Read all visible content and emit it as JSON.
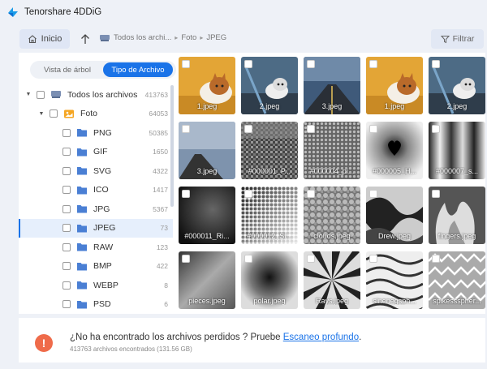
{
  "app": {
    "title": "Tenorshare 4DDiG"
  },
  "nav": {
    "home_label": "Inicio",
    "breadcrumb": [
      "Todos los archi...",
      "Foto",
      "JPEG"
    ],
    "filter_label": "Filtrar"
  },
  "sidebar": {
    "view_tree_label": "Vista de árbol",
    "view_type_label": "Tipo de Archivo",
    "all_files": {
      "label": "Todos los archivos",
      "count": "413763"
    },
    "photo": {
      "label": "Foto",
      "count": "64053"
    },
    "items": [
      {
        "label": "PNG",
        "count": "50385"
      },
      {
        "label": "GIF",
        "count": "1650"
      },
      {
        "label": "SVG",
        "count": "4322"
      },
      {
        "label": "ICO",
        "count": "1417"
      },
      {
        "label": "JPG",
        "count": "5367"
      },
      {
        "label": "JPEG",
        "count": "73"
      },
      {
        "label": "RAW",
        "count": "123"
      },
      {
        "label": "BMP",
        "count": "422"
      },
      {
        "label": "WEBP",
        "count": "8"
      },
      {
        "label": "PSD",
        "count": "6"
      }
    ]
  },
  "files": [
    {
      "name": "1.jpeg"
    },
    {
      "name": "2.jpeg"
    },
    {
      "name": "3.jpeg"
    },
    {
      "name": "1.jpeg"
    },
    {
      "name": "2.jpeg"
    },
    {
      "name": "3.jpeg"
    },
    {
      "name": "#000001_P..."
    },
    {
      "name": "#000004_pi..."
    },
    {
      "name": "#000005_H..."
    },
    {
      "name": "#000007_s..."
    },
    {
      "name": "#000011_Ri..."
    },
    {
      "name": "#000012_Si..."
    },
    {
      "name": "clouds.jpeg"
    },
    {
      "name": "Drew.jpeg"
    },
    {
      "name": "fingers.jpeg"
    },
    {
      "name": "pieces.jpeg"
    },
    {
      "name": "polar.jpeg"
    },
    {
      "name": "Rays.jpeg"
    },
    {
      "name": "sinenegsph..."
    },
    {
      "name": "spikessspher..."
    }
  ],
  "footer": {
    "question": "¿No ha encontrado los archivos perdidos ? Pruebe ",
    "link": "Escaneo profundo",
    "period": ".",
    "found": "413763 archivos encontrados (131.56 GB)"
  }
}
